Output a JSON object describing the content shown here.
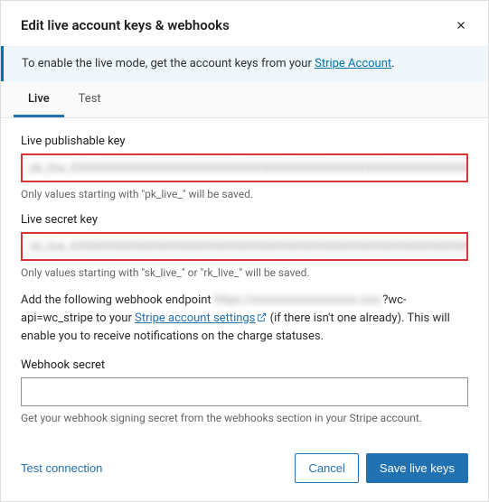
{
  "header": {
    "title": "Edit live account keys & webhooks"
  },
  "notice": {
    "prefix": "To enable the live mode, get the account keys from your ",
    "link_text": "Stripe Account",
    "suffix": "."
  },
  "tabs": [
    {
      "label": "Live",
      "active": true
    },
    {
      "label": "Test",
      "active": false
    }
  ],
  "fields": {
    "publishable": {
      "label": "Live publishable key",
      "value_redacted": "pk_live_XXXXXXXXXXXXXXXXXXXXXXXXXXXXXXXXXXXXXXXXXXXXXXXXXXXXXXXXXXXXXXXXXXXXXXXXXXXXXXXX",
      "help": "Only values starting with \"pk_live_\" will be saved."
    },
    "secret": {
      "label": "Live secret key",
      "value_redacted": "sk_live_XXXXXXXXXXXXXXXXXXXXXXXXXXXXXXXXXXXXXXXXXXXXXXXXXXXXXXXXXXXXXXXXXXXXXXXXXXXXXXXX",
      "help": "Only values starting with \"sk_live_\" or \"rk_live_\" will be saved."
    },
    "webhook_instruction": {
      "prefix": "Add the following webhook endpoint ",
      "url_redacted_part": "https://xxxxxxxxxxxxxxxxxx.xxx/",
      "url_visible_part": "?wc-api=wc_stripe",
      "mid": " to your ",
      "link_text": "Stripe account settings",
      "suffix": " (if there isn't one already). This will enable you to receive notifications on the charge statuses."
    },
    "webhook_secret": {
      "label": "Webhook secret",
      "value": "",
      "help": "Get your webhook signing secret from the webhooks section in your Stripe account."
    }
  },
  "footer": {
    "test_connection": "Test connection",
    "cancel": "Cancel",
    "save": "Save live keys"
  }
}
